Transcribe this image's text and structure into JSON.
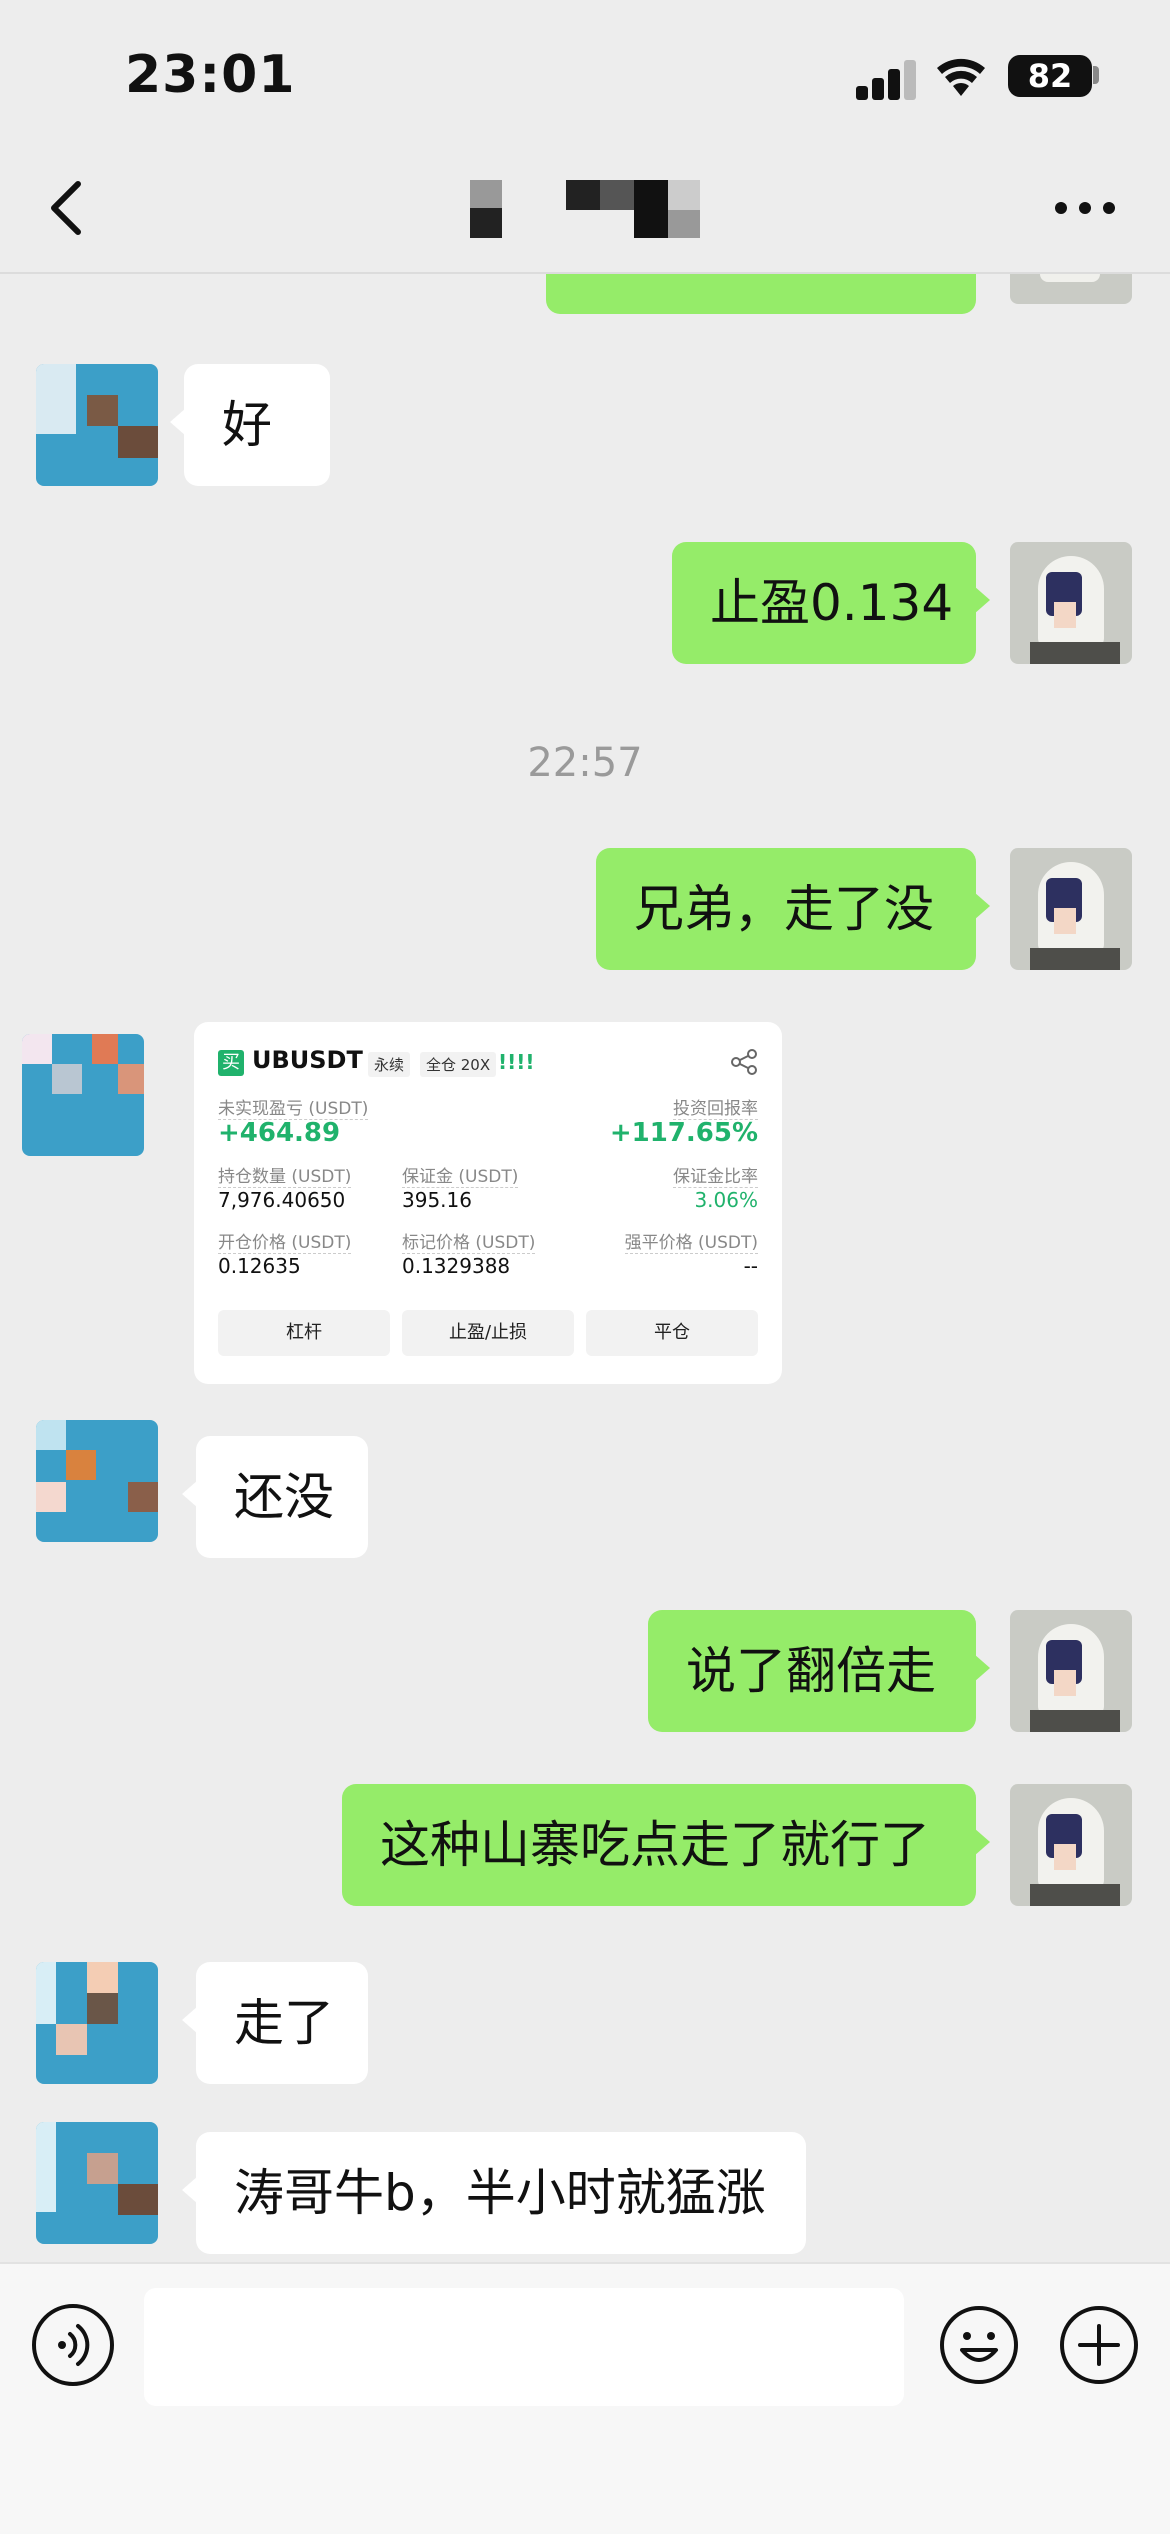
{
  "status_bar": {
    "time": "23:01",
    "battery": "82"
  },
  "nav": {
    "back_icon": "chevron-left-icon",
    "more_icon": "more-dots-icon"
  },
  "messages": {
    "m0": "",
    "m1": "好",
    "m2": "止盈0.134",
    "timestamp": "22:57",
    "m3": "兄弟，走了没",
    "m5": "还没",
    "m6": "说了翻倍走",
    "m7": "这种山寨吃点走了就行了",
    "m8": "走了",
    "m9": "涛哥牛b，半小时就猛涨"
  },
  "card": {
    "buy_tag": "买",
    "pair": "UBUSDT",
    "tag_perpetual": "永续",
    "tag_leverage": "全仓 20X",
    "bars": "!!!!",
    "unrealized_label": "未实现盈亏 (USDT)",
    "unrealized_value": "+464.89",
    "roi_label": "投资回报率",
    "roi_value": "+117.65%",
    "position_label": "持仓数量 (USDT)",
    "position_value": "7,976.40650",
    "margin_label": "保证金 (USDT)",
    "margin_value": "395.16",
    "margin_ratio_label": "保证金比率",
    "margin_ratio_value": "3.06%",
    "entry_label": "开仓价格 (USDT)",
    "entry_value": "0.12635",
    "mark_label": "标记价格 (USDT)",
    "mark_value": "0.1329388",
    "liq_label": "强平价格 (USDT)",
    "liq_value": "--",
    "btn_leverage": "杠杆",
    "btn_tpsl": "止盈/止损",
    "btn_close": "平仓"
  },
  "colors": {
    "my_bubble": "#95ec69",
    "other_bubble": "#ffffff",
    "background": "#ededed",
    "profit": "#20b26c"
  },
  "input_bar": {
    "value": ""
  }
}
